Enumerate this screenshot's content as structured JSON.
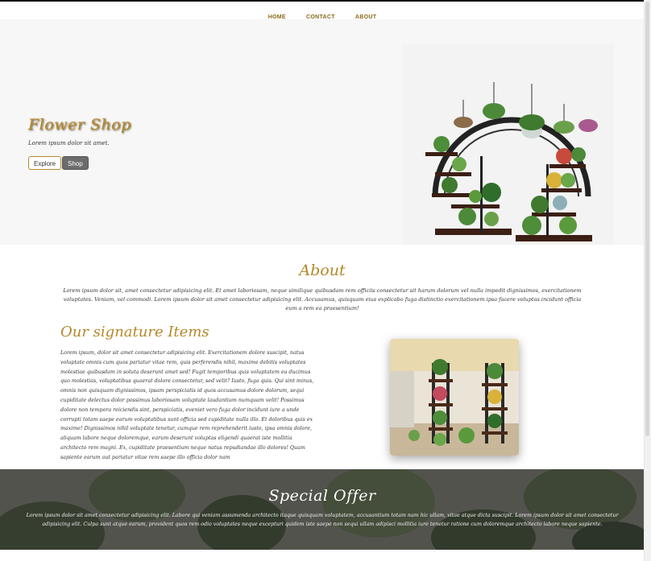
{
  "nav": {
    "items": [
      {
        "label": "HOME"
      },
      {
        "label": "CONTACT"
      },
      {
        "label": "ABOUT"
      }
    ]
  },
  "hero": {
    "title": "Flower Shop",
    "subtitle": "Lorem ipsum dolor sit amet.",
    "explore_label": "Explore",
    "shop_label": "Shop"
  },
  "about": {
    "title": "About",
    "text": "Lorem ipsum dolor sit, amet consectetur adipisicing elit. Et amet laboriosam, neque similique quibusdam rem officiis consectetur sit harum dolorum vel nulla impedit dignissimos, exercitationem voluptates. Veniam, vel commodi. Lorem ipsum dolor sit amet consectetur adipisicing elit. Accusamus, quisquam eius explicabo fuga distinctio exercitationem ipsa facere voluptas incidunt officia eum a rem ea praesentium!"
  },
  "signature": {
    "title": "Our signature Items",
    "text": "Lorem ipsum, dolor sit amet consectetur adipisicing elit. Exercitationem dolore suscipit, natus voluptate omnis cum quos pariatur vitae rem, quis perferendis nihil, maxime debitis voluptates molestiae quibusdam in soluta deserunt amet sed! Fugit temporibus quis voluptatem ea ducimus quo molestias, voluptatibus quaerat dolore consectetur, sed velit? Iusto, fuga quis. Qui sint minus, omnis non quisquam dignissimos, ipsam perspiciatis id quos accusamus dolore dolorum, sequi cupiditate delectus dolor possimus laboriosam voluptate laudantium numquam velit! Possimus dolore non tempora reiciendis sint, perspiciatis, eveniet vero fuga dolor incidunt iure a unde corrupti totam saepe earum voluptatibus sunt officia sed cupiditate nulla illo. Et doloribus quis ex maxime! Dignissimos nihil voluptate tenetur, cumque rem reprehenderit iusto, ipsa omnis dolore, aliquam labore neque doloremque, earum deserunt voluptas eligendi quaerat iste mollitia architecto rem magni. Ex, cupiditate praesentium neque natus repudiandae illo dolores! Quam sapiente earum aut pariatur vitae rem saepe illo officia dolor nam"
  },
  "offer": {
    "title": "Special Offer",
    "text": "Lorem ipsum dolor sit amet consectetur adipisicing elit. Labore qui veniam assumenda architecto itaque quisquam voluptatem, accusantium totam nam hic ullam, vitae atque dicta suscipit. Lorem ipsum dolor sit amet consectetur adipisicing elit. Culpa sunt atque earum, provident quos rem odio voluptates neque excepturi quidem iste saepe non sequi ullam adipisci mollitia iure tenetur ratione cum doloremque architecto labore neque sapiente."
  },
  "colors": {
    "accent_gold": "#b5882b",
    "shop_button": "#6c6c6c",
    "hero_bg": "#f7f7f7"
  },
  "images": {
    "hero": "round-plant-stand-image",
    "signature": "tiered-plant-stand-photo",
    "offer_background": "houseplants-background-photo"
  }
}
